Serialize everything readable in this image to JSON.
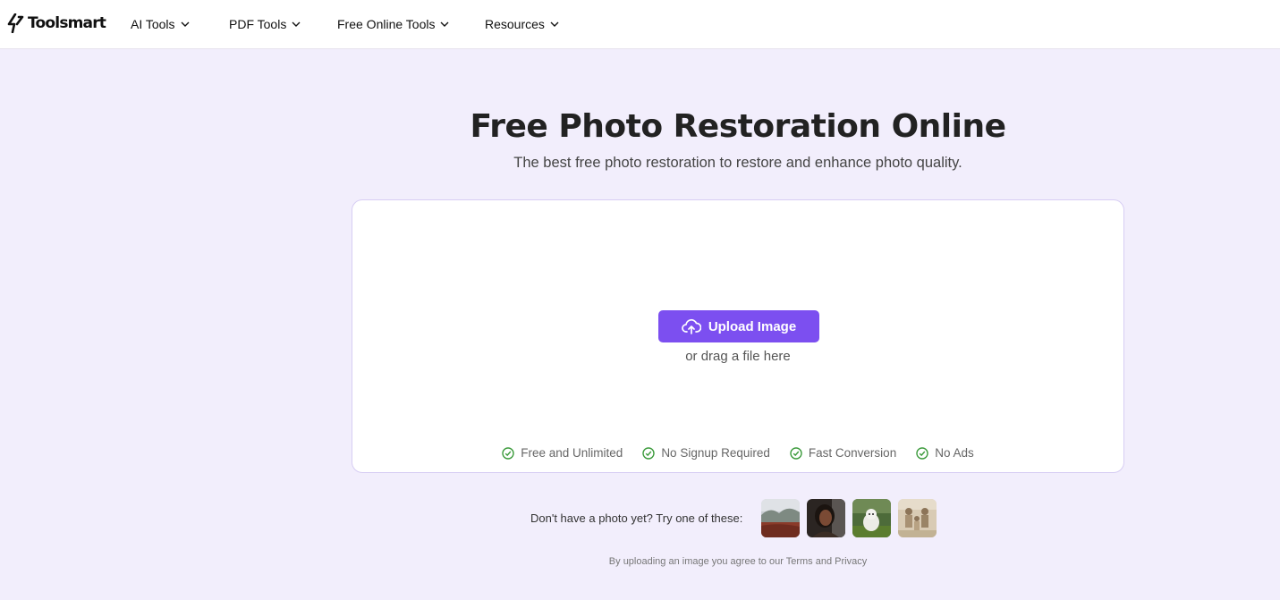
{
  "brand": {
    "name": "Toolsmart"
  },
  "nav": {
    "items": [
      {
        "label": "AI Tools"
      },
      {
        "label": "PDF Tools"
      },
      {
        "label": "Free Online Tools"
      },
      {
        "label": "Resources"
      }
    ]
  },
  "hero": {
    "title": "Free Photo Restoration Online",
    "subtitle": "The best free photo restoration to restore and enhance photo quality."
  },
  "upload": {
    "button_label": "Upload Image",
    "drag_text": "or drag a file here",
    "features": [
      {
        "label": "Free and Unlimited"
      },
      {
        "label": "No Signup Required"
      },
      {
        "label": "Fast Conversion"
      },
      {
        "label": "No Ads"
      }
    ]
  },
  "samples": {
    "label": "Don't have a photo yet? Try one of these:",
    "items": [
      {
        "name": "landscape"
      },
      {
        "name": "woman-portrait"
      },
      {
        "name": "dog"
      },
      {
        "name": "family"
      }
    ]
  },
  "footer": {
    "terms_text": "By uploading an image you agree to our Terms and Privacy"
  },
  "colors": {
    "accent": "#7c4ff0",
    "background": "#f2eefc",
    "check": "#3a9a3a"
  }
}
